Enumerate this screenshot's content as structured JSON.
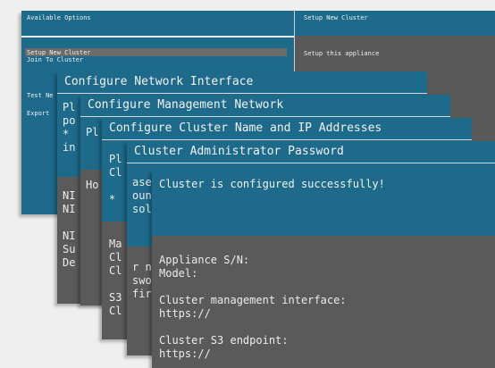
{
  "background_window": {
    "header_left": "Available Options",
    "header_right": "Setup New Cluster",
    "options": [
      "Setup New Cluster",
      "Join To Cluster"
    ],
    "right_description": "Setup this appliance",
    "extra_left": [
      "Test Ne",
      "Export"
    ]
  },
  "windows": [
    {
      "title": "Configure Network Interface",
      "body_top": "Pl\npo\n*\nin",
      "body_bottom": "NI\nNI\n\nNI\nSu\nDe"
    },
    {
      "title": "Configure Management Network",
      "body_top": "Pl",
      "body_bottom": "Ho"
    },
    {
      "title": "Configure Cluster Name and IP Addresses",
      "body_top": "Pl\nCl\n\n*",
      "body_bottom": "Ma\nCl\nCl\n\nS3\nCl"
    },
    {
      "title": "Cluster Administrator Password",
      "body_top": "ase\nount\nsolo",
      "body_bottom": "r na\nswor\nfirm"
    }
  ],
  "final_window": {
    "title": "Cluster is configured successfully!",
    "lines": "Appliance S/N:\nModel:\n\nCluster management interface:\nhttps://\n\nCluster S3 endpoint:\nhttps://"
  }
}
